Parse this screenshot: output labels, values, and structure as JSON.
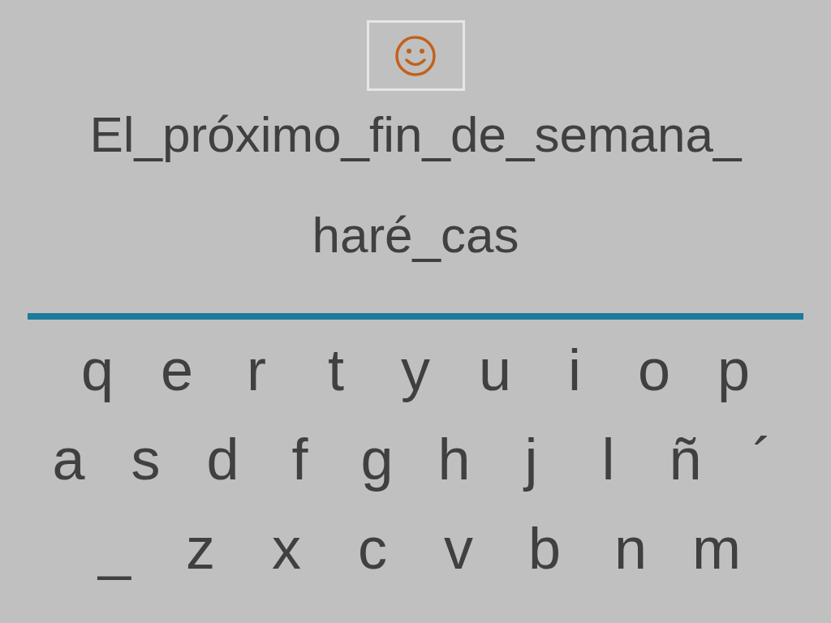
{
  "sentence_lines": [
    "El_próximo_fin_de_semana_",
    "haré_cas"
  ],
  "keyboard_rows": [
    [
      "q",
      "e",
      "r",
      "t",
      "y",
      "u",
      "i",
      "o",
      "p"
    ],
    [
      "a",
      "s",
      "d",
      "f",
      "g",
      "h",
      "j",
      "l",
      "ñ",
      "´"
    ],
    [
      "_",
      "z",
      "x",
      "c",
      "v",
      "b",
      "n",
      "m"
    ]
  ]
}
